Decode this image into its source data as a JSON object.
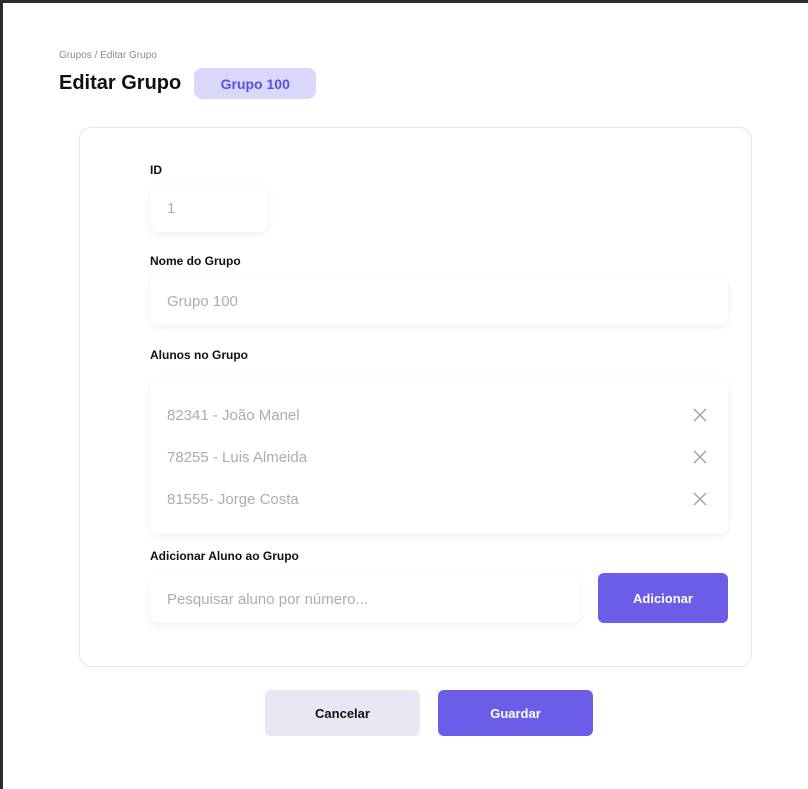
{
  "breadcrumb": "Grupos / Editar Grupo",
  "header": {
    "title": "Editar Grupo",
    "badge": "Grupo 100"
  },
  "form": {
    "id_label": "ID",
    "id_value": "1",
    "name_label": "Nome do Grupo",
    "name_value": "Grupo 100",
    "students_label": "Alunos no Grupo",
    "students": [
      {
        "text": "82341 - João Manel"
      },
      {
        "text": "78255 - Luis Almeida"
      },
      {
        "text": "81555- Jorge Costa"
      }
    ],
    "add_label": "Adicionar Aluno ao Grupo",
    "search_placeholder": "Pesquisar aluno por número...",
    "add_button": "Adicionar"
  },
  "actions": {
    "cancel": "Cancelar",
    "save": "Guardar"
  },
  "colors": {
    "accent": "#6b5de8",
    "badge_bg": "#d9d8fb",
    "badge_text": "#5b4fe0",
    "muted_text": "#a9adb6"
  },
  "icons": {
    "remove": "close-icon"
  }
}
